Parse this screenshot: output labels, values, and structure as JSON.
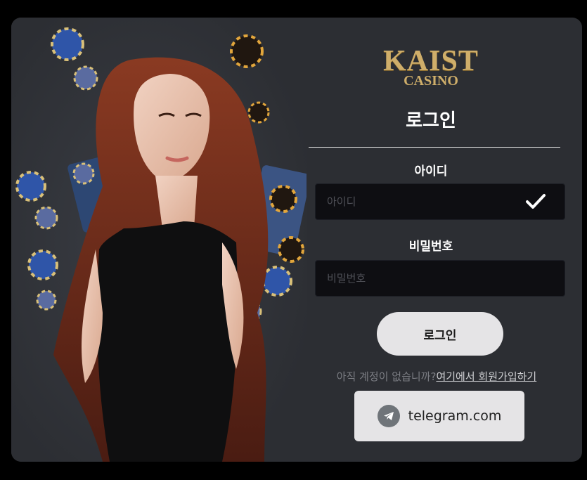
{
  "brand": {
    "name": "KAIST",
    "sub": "CASINO"
  },
  "login": {
    "title": "로그인",
    "id_label": "아이디",
    "id_placeholder": "아이디",
    "id_value": "",
    "password_label": "비밀번호",
    "password_placeholder": "비밀번호",
    "password_value": "",
    "submit_label": "로그인"
  },
  "signup": {
    "prompt": "아직 계정이 없습니까?",
    "link_text": "여기에서 회원가입하기"
  },
  "telegram": {
    "label": "telegram.com",
    "icon": "telegram-icon"
  },
  "colors": {
    "gold": "#cfae6a",
    "card": "#2c2e33",
    "button": "#e5e4e6",
    "input_bg": "#0e0e12"
  }
}
